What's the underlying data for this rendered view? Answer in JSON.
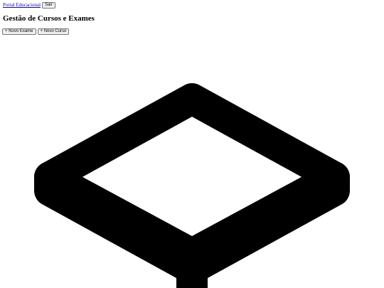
{
  "header": {
    "home_link": "Portal Educacional",
    "logout_label": "Sair"
  },
  "page": {
    "title": "Gestão de Cursos e Exames"
  },
  "actions": {
    "new_exam_label": "+ Novo Exame",
    "new_course_label": "+ Novo Curso"
  },
  "graphic": {
    "icon": "large-diamond-outline-icon",
    "color": "#000000"
  }
}
